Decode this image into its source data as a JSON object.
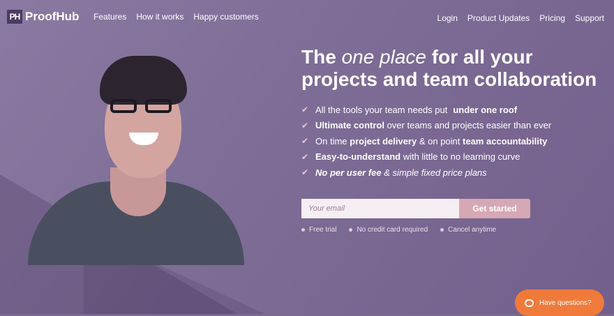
{
  "nav": {
    "logo_mark": "PH",
    "logo_text": "ProofHub",
    "left": [
      "Features",
      "How it works",
      "Happy customers"
    ],
    "right": [
      "Login",
      "Product Updates",
      "Pricing",
      "Support"
    ]
  },
  "hero": {
    "headline_pre": "The ",
    "headline_em": "one place",
    "headline_post": " for all your projects and team collaboration",
    "features": [
      {
        "a": "All the tools your team needs put ",
        "b": "under one roof",
        "c": ""
      },
      {
        "a": "",
        "b": "Ultimate control",
        "c": " over teams and projects easier than ever"
      },
      {
        "a": "On time ",
        "b": "project delivery",
        "c": " & on point "
      },
      {
        "a": "",
        "b": "Easy-to-understand",
        "c": " with little to no learning curve"
      },
      {
        "a": "",
        "b": "No per user fee",
        "c": " & simple fixed price plans"
      }
    ],
    "feature3_tail": "team accountability",
    "email_placeholder": "Your email",
    "cta_label": "Get started",
    "perks": [
      "Free trial",
      "No credit card required",
      "Cancel anytime"
    ]
  },
  "chat": {
    "label": "Have questions?"
  },
  "colors": {
    "bg": "#7a6a92",
    "cta": "#d6a8b3",
    "chat": "#f07a3a"
  }
}
